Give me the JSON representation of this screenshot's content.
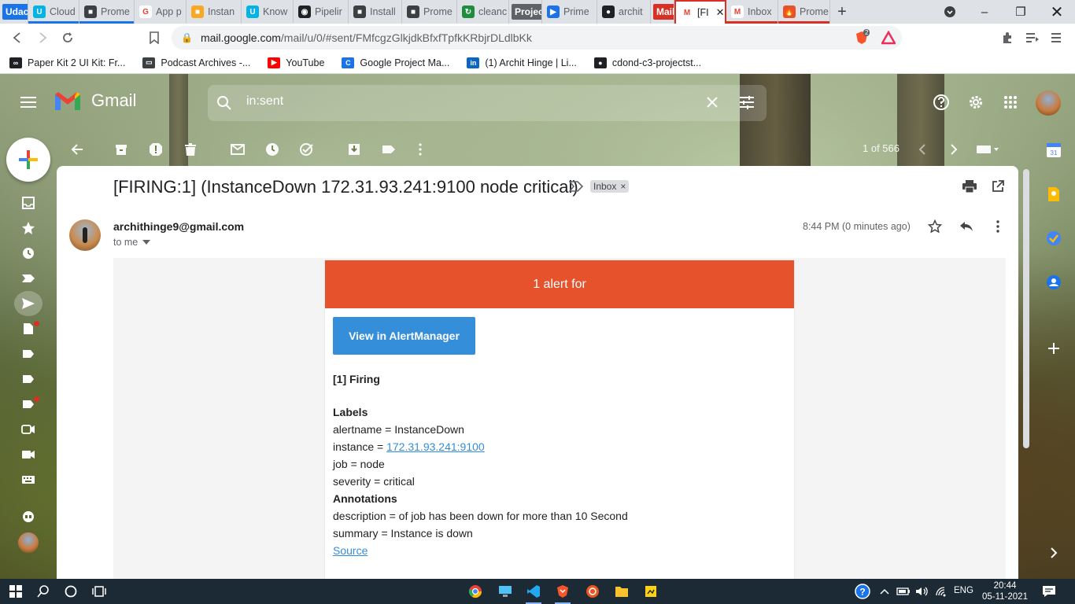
{
  "browser": {
    "tabs": [
      {
        "label": "Udacity",
        "kind": "chip",
        "color": "#1a73e8"
      },
      {
        "label": "Cloud",
        "fav_color": "#02b3e4",
        "fav": "U",
        "group": "blue"
      },
      {
        "label": "Prome",
        "fav_color": "#3c4043",
        "fav": "■",
        "group": "blue"
      },
      {
        "label": "App p",
        "fav_color": "#ffffff",
        "fav": "G"
      },
      {
        "label": "Instan",
        "fav_color": "#f9a825",
        "fav": "■"
      },
      {
        "label": "Know",
        "fav_color": "#02b3e4",
        "fav": "U"
      },
      {
        "label": "Pipelir",
        "fav_color": "#202124",
        "fav": "◉"
      },
      {
        "label": "Install",
        "fav_color": "#3c4043",
        "fav": "■"
      },
      {
        "label": "Prome",
        "fav_color": "#3c4043",
        "fav": "■"
      },
      {
        "label": "cleanc",
        "fav_color": "#1e8e3e",
        "fav": "↻"
      },
      {
        "label": "Project",
        "kind": "chip",
        "color": "#5f6368"
      },
      {
        "label": "Prime",
        "fav_color": "#1a73e8",
        "fav": "▶"
      },
      {
        "label": "archit",
        "fav_color": "#202124",
        "fav": "●"
      },
      {
        "label": "Mail",
        "kind": "chip",
        "color": "#d93025"
      },
      {
        "label": "[FI",
        "fav_color": "#ffffff",
        "fav": "M",
        "active": true
      },
      {
        "label": "Inbox",
        "fav_color": "#ffffff",
        "fav": "M",
        "group": "red"
      },
      {
        "label": "Prome",
        "fav_color": "#e6522c",
        "fav": "🔥",
        "group": "red"
      }
    ],
    "url_host": "mail.google.com",
    "url_path": "/mail/u/0/#sent/FMfcgzGlkjdkBfxfTpfkKRbjrDLdlbKk",
    "brave_badge": "2",
    "bookmarks": [
      {
        "label": "Paper Kit 2 UI Kit: Fr...",
        "color": "#202124",
        "icon": "∞"
      },
      {
        "label": "Podcast Archives -...",
        "color": "#3c4043",
        "icon": "▭"
      },
      {
        "label": "YouTube",
        "color": "#ff0000",
        "icon": "▶"
      },
      {
        "label": "Google Project Ma...",
        "color": "#1a73e8",
        "icon": "C"
      },
      {
        "label": "(1) Archit Hinge | Li...",
        "color": "#0a66c2",
        "icon": "in"
      },
      {
        "label": "cdond-c3-projectst...",
        "color": "#202124",
        "icon": "●"
      }
    ]
  },
  "gmail": {
    "app_name": "Gmail",
    "search_value": "in:sent",
    "pager": "1 of 566",
    "subject": "[FIRING:1] (InstanceDown 172.31.93.241:9100 node critical)",
    "label_chip": "Inbox",
    "label_chip_remove": "×",
    "sender": "archithinge9@gmail.com",
    "to": "to me",
    "time": "8:44 PM (0 minutes ago)",
    "email": {
      "header_text": "1 alert for",
      "button_label": "View in AlertManager",
      "firing": "[1] Firing",
      "labels_heading": "Labels",
      "alertname": "alertname = InstanceDown",
      "instance_prefix": "instance = ",
      "instance_link": "172.31.93.241:9100",
      "job": "job = node",
      "severity": "severity = critical",
      "annotations_heading": "Annotations",
      "description": "description = of job has been down for more than 10 Second",
      "summary": "summary = Instance is down",
      "source_link": "Source"
    },
    "colors": {
      "alert_header": "#e6522c",
      "alert_button": "#348eda"
    }
  },
  "taskbar": {
    "lang": "ENG",
    "time": "20:44",
    "date": "05-11-2021"
  }
}
